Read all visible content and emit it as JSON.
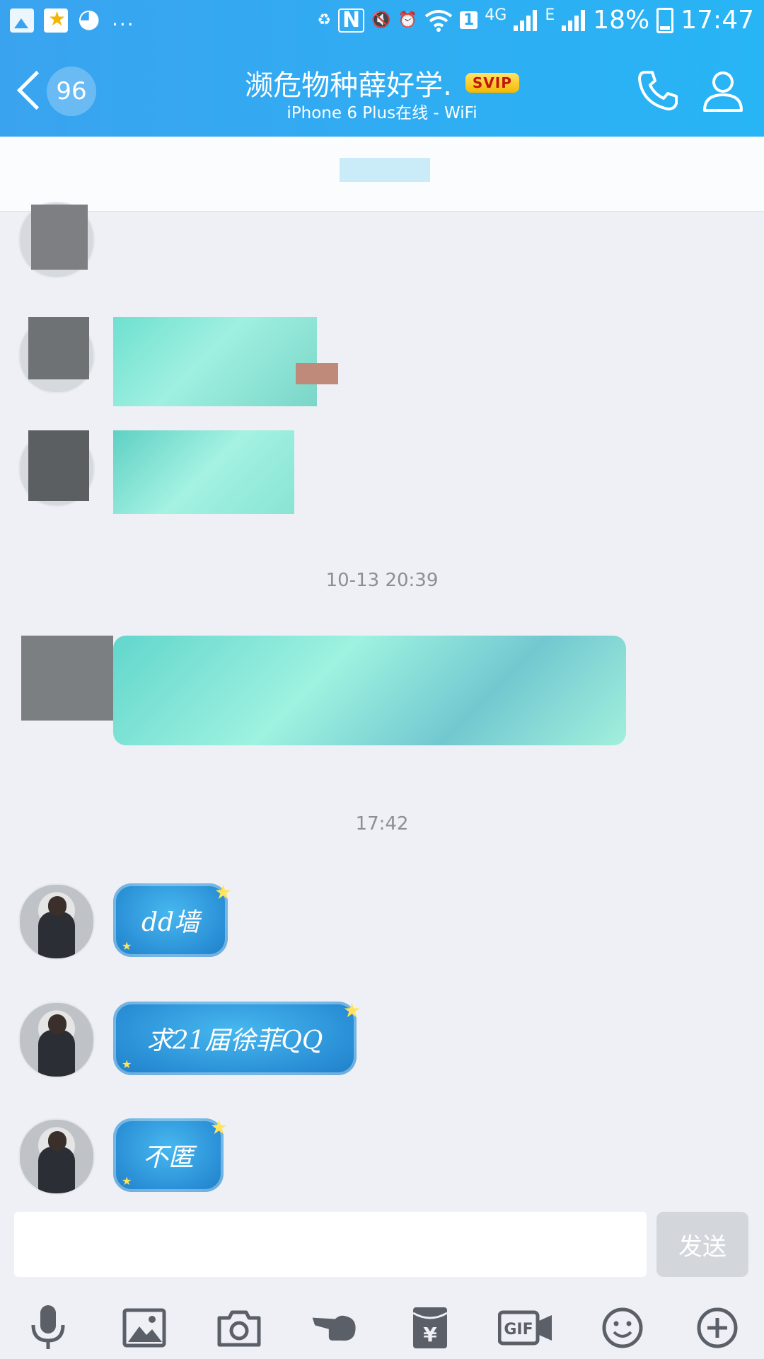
{
  "status_bar": {
    "dots": "...",
    "nfc": "N",
    "sim_badge": "1",
    "net_4g": "4G",
    "net_e": "E",
    "battery_pct": "18%",
    "time": "17:47"
  },
  "header": {
    "back_count": "96",
    "title": "濒危物种薛好学.",
    "badge": "SVIP",
    "subtitle": "iPhone 6 Plus在线 - WiFi"
  },
  "chat": {
    "timestamps": [
      "10-13 20:39",
      "17:42"
    ],
    "messages": [
      {
        "text": "dd墙"
      },
      {
        "text": "求21届徐菲QQ"
      },
      {
        "text": "不匿"
      }
    ]
  },
  "input": {
    "placeholder": "",
    "send_label": "发送"
  },
  "toolbar": {
    "items": [
      "voice-icon",
      "image-icon",
      "camera-icon",
      "poke-icon",
      "red-packet-icon",
      "gif-icon",
      "emoji-icon",
      "plus-icon"
    ],
    "gif_label": "GIF",
    "yen": "¥"
  },
  "colors": {
    "header_start": "#3aa3ef",
    "header_end": "#27b5f5",
    "bubble": "#2a8fd6",
    "svip_bg": "#f5b800",
    "svip_text": "#c2160b",
    "background": "#eef0f5"
  }
}
